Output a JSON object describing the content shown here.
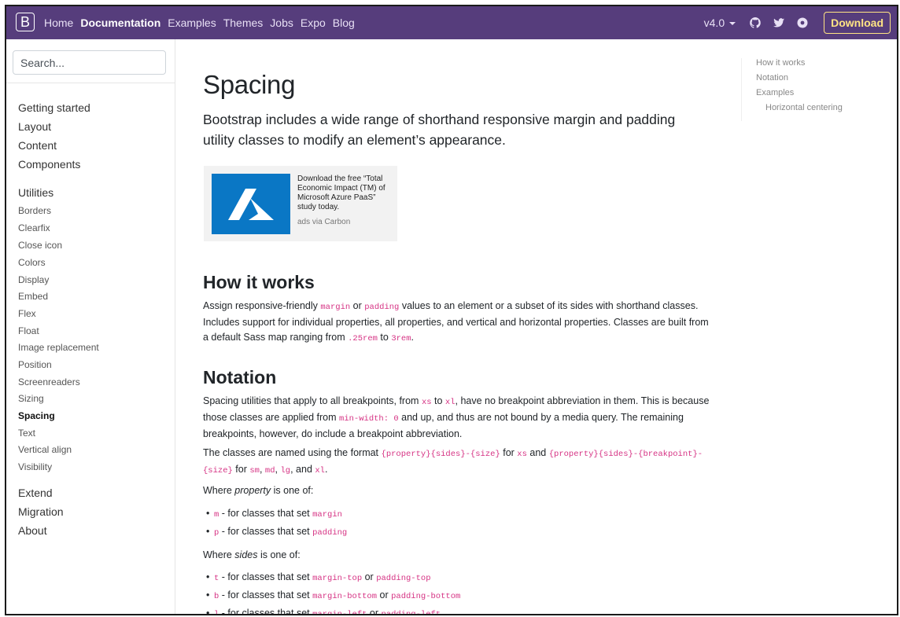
{
  "navbar": {
    "brand": "B",
    "links": [
      "Home",
      "Documentation",
      "Examples",
      "Themes",
      "Jobs",
      "Expo",
      "Blog"
    ],
    "active": "Documentation",
    "version": "v4.0",
    "download_label": "Download"
  },
  "sidebar": {
    "search_placeholder": "Search...",
    "groups_top": [
      "Getting started",
      "Layout",
      "Content",
      "Components"
    ],
    "utilities_label": "Utilities",
    "utilities": [
      "Borders",
      "Clearfix",
      "Close icon",
      "Colors",
      "Display",
      "Embed",
      "Flex",
      "Float",
      "Image replacement",
      "Position",
      "Screenreaders",
      "Sizing",
      "Spacing",
      "Text",
      "Vertical align",
      "Visibility"
    ],
    "active_item": "Spacing",
    "groups_bottom": [
      "Extend",
      "Migration",
      "About"
    ]
  },
  "main": {
    "title": "Spacing",
    "lead": "Bootstrap includes a wide range of shorthand responsive margin and padding utility classes to modify an element’s appearance.",
    "ad": {
      "text": "Download the free “Total Economic Impact (TM) of Microsoft Azure PaaS” study today.",
      "via": "ads via Carbon"
    },
    "how_it_works": {
      "heading": "How it works",
      "p_1": "Assign responsive-friendly ",
      "c_margin": "margin",
      "p_2": " or ",
      "c_padding": "padding",
      "p_3": " values to an element or a subset of its sides with shorthand classes. Includes support for individual properties, all properties, and vertical and horizontal properties. Classes are built from a default Sass map ranging from ",
      "c_min": ".25rem",
      "p_4": " to ",
      "c_max": "3rem",
      "p_5": "."
    },
    "notation": {
      "heading": "Notation",
      "p1_a": "Spacing utilities that apply to all breakpoints, from ",
      "p1_xs": "xs",
      "p1_b": " to ",
      "p1_xl": "xl",
      "p1_c": ", have no breakpoint abbreviation in them. This is because those classes are applied from ",
      "p1_code": "min-width: 0",
      "p1_d": " and up, and thus are not bound by a media query. The remaining breakpoints, however, do include a breakpoint abbreviation.",
      "p2_a": "The classes are named using the format ",
      "p2_fmt1": "{property}{sides}-{size}",
      "p2_b": " for ",
      "p2_xs": "xs",
      "p2_c": " and ",
      "p2_fmt2": "{property}{sides}-{breakpoint}-{size}",
      "p2_d": " for ",
      "p2_sm": "sm",
      "p2_e": ", ",
      "p2_md": "md",
      "p2_f": ", ",
      "p2_lg": "lg",
      "p2_g": ", and ",
      "p2_xl": "xl",
      "p2_h": ".",
      "property_a": "Where ",
      "property_em": "property",
      "property_b": " is one of:",
      "property_items": [
        {
          "key": "m",
          "text": " - for classes that set ",
          "value": "margin"
        },
        {
          "key": "p",
          "text": " - for classes that set ",
          "value": "padding"
        }
      ],
      "sides_a": "Where ",
      "sides_em": "sides",
      "sides_b": " is one of:",
      "sides_items": [
        {
          "key": "t",
          "text": " - for classes that set ",
          "v1": "margin-top",
          "or": " or ",
          "v2": "padding-top"
        },
        {
          "key": "b",
          "text": " - for classes that set ",
          "v1": "margin-bottom",
          "or": " or ",
          "v2": "padding-bottom"
        },
        {
          "key": "l",
          "text": " - for classes that set ",
          "v1": "margin-left",
          "or": " or ",
          "v2": "padding-left"
        }
      ]
    }
  },
  "toc": {
    "items": [
      "How it works",
      "Notation",
      "Examples"
    ],
    "sub_items": [
      "Horizontal centering"
    ]
  },
  "colors": {
    "navbar_bg": "#563d7c",
    "download_accent": "#ffe484",
    "code_pink": "#d63384",
    "ad_logo_blue": "#0a77c5"
  }
}
